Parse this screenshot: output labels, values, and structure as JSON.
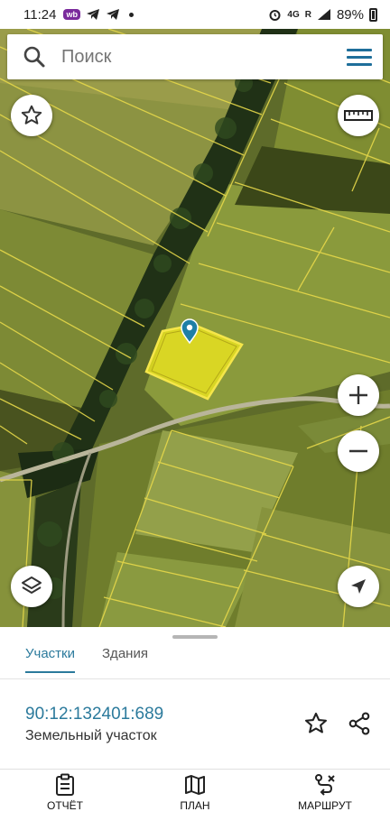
{
  "status_bar": {
    "time": "11:24",
    "app_badge": "wb",
    "network": "4G",
    "signal_text": "R",
    "battery": "89%"
  },
  "search": {
    "placeholder": "Поиск"
  },
  "bottom_sheet": {
    "tabs": [
      {
        "label": "Участки",
        "active": true
      },
      {
        "label": "Здания",
        "active": false
      }
    ],
    "parcel": {
      "id": "90:12:132401:689",
      "type": "Земельный участок"
    }
  },
  "bottom_nav": {
    "items": [
      {
        "label": "ОТЧЁТ",
        "icon": "report-icon"
      },
      {
        "label": "ПЛАН",
        "icon": "map-plan-icon"
      },
      {
        "label": "МАРШРУТ",
        "icon": "route-icon"
      }
    ]
  },
  "colors": {
    "accent": "#2b7a9c",
    "parcel_fill": "#e6e020",
    "parcel_border": "#f0e040",
    "marker": "#1e7fa6"
  }
}
